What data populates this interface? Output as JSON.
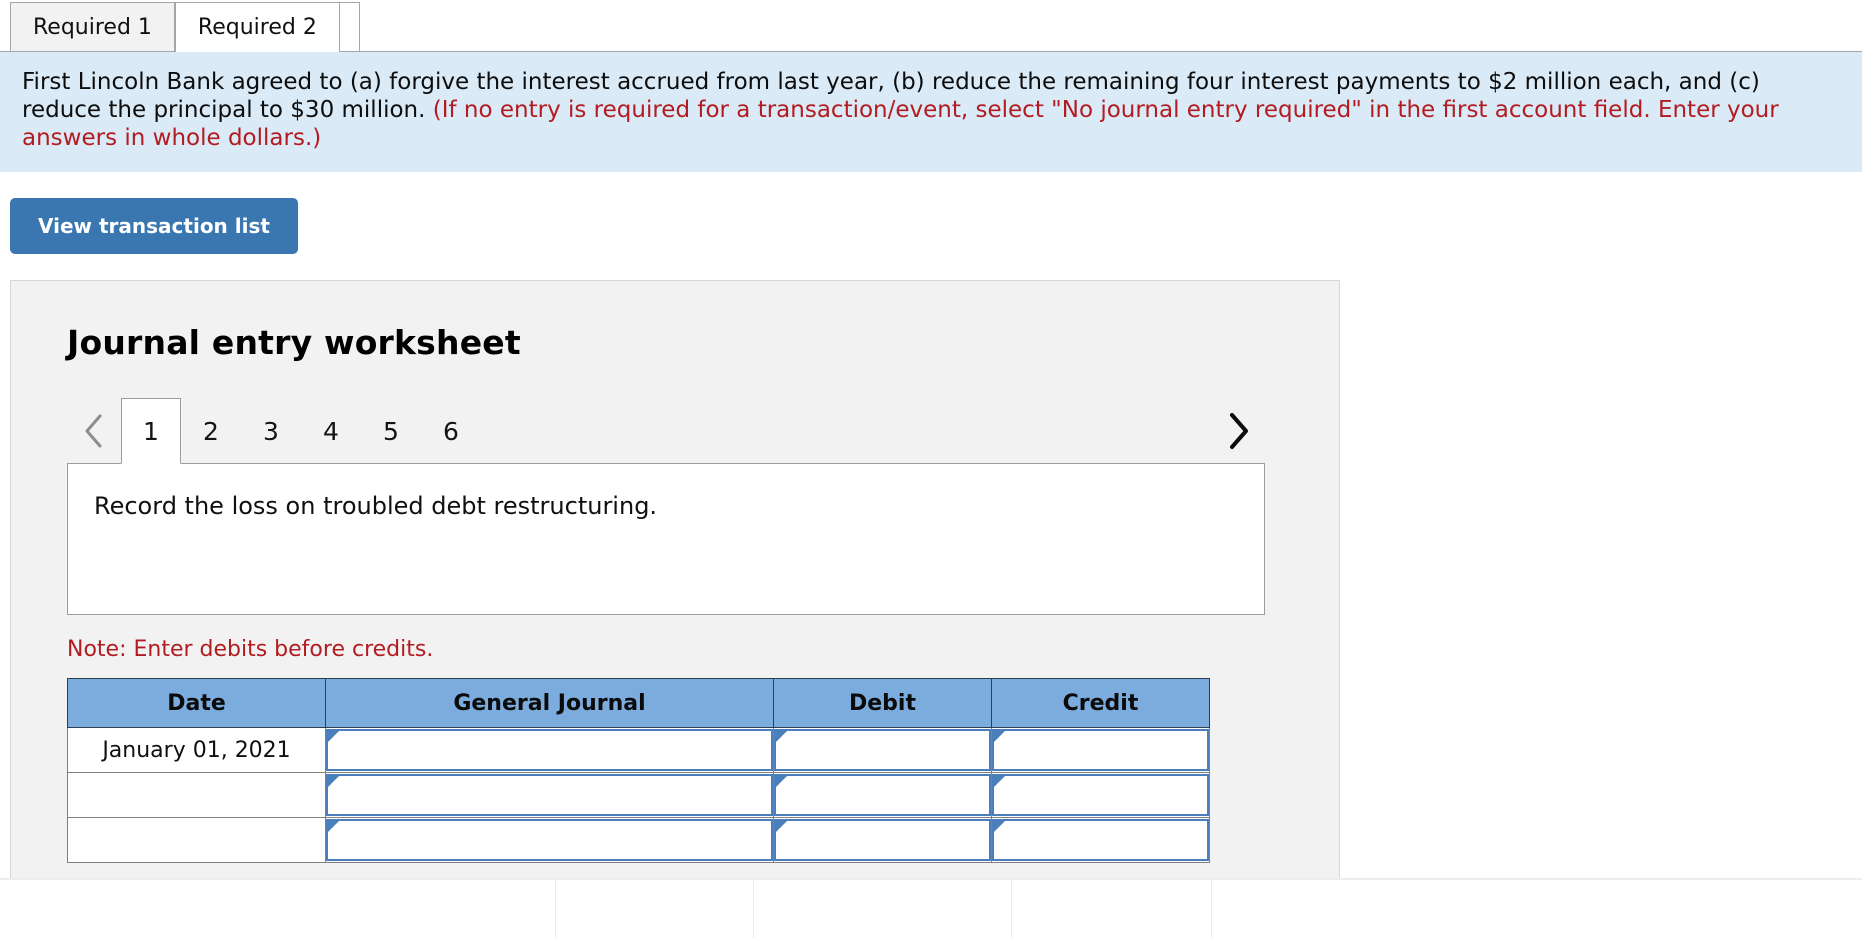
{
  "requirement_tabs": [
    {
      "label": "Required 1",
      "active": false
    },
    {
      "label": "Required 2",
      "active": true
    }
  ],
  "instruction": {
    "body": "First Lincoln Bank agreed to (a) forgive the interest accrued from last year, (b) reduce the remaining four interest payments to $2 million each, and (c) reduce the principal to $30 million. ",
    "hint": "(If no entry is required for a transaction/event, select \"No journal entry required\" in the first account field. Enter your answers in whole dollars.)"
  },
  "toolbar": {
    "view_transaction_list_label": "View transaction list"
  },
  "worksheet": {
    "title": "Journal entry worksheet",
    "prev_icon": "chevron-left-icon",
    "next_icon": "chevron-right-icon",
    "entry_tabs": [
      {
        "label": "1",
        "active": true
      },
      {
        "label": "2",
        "active": false
      },
      {
        "label": "3",
        "active": false
      },
      {
        "label": "4",
        "active": false
      },
      {
        "label": "5",
        "active": false
      },
      {
        "label": "6",
        "active": false
      }
    ],
    "task_description": "Record the loss on troubled debt restructuring.",
    "note": "Note: Enter debits before credits."
  },
  "journal_table": {
    "columns": [
      "Date",
      "General Journal",
      "Debit",
      "Credit"
    ],
    "rows": [
      {
        "date": "January 01, 2021",
        "general_journal": "",
        "debit": "",
        "credit": ""
      },
      {
        "date": "",
        "general_journal": "",
        "debit": "",
        "credit": ""
      },
      {
        "date": "",
        "general_journal": "",
        "debit": "",
        "credit": ""
      }
    ]
  },
  "colors": {
    "accent_blue": "#3a76b0",
    "banner_blue": "#daeaf7",
    "header_blue": "#7bacdd",
    "warning_red": "#b21c20",
    "panel_gray": "#f2f2f2"
  }
}
